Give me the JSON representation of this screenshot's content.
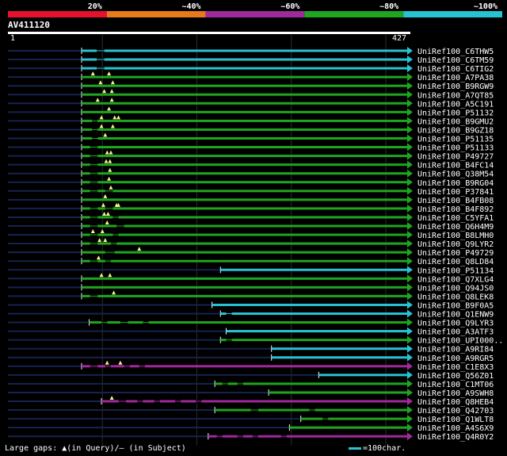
{
  "legend": {
    "segments": [
      {
        "label": "20%",
        "color": "#e8112d"
      },
      {
        "label": "~40%",
        "color": "#e87a1e"
      },
      {
        "label": "~60%",
        "color": "#a0299c"
      },
      {
        "label": "~80%",
        "color": "#1fa51f"
      },
      {
        "label": "~100%",
        "color": "#27c3d3"
      }
    ]
  },
  "query": {
    "name": "AV411120",
    "start": "1",
    "end": "427",
    "length": 427
  },
  "footer": {
    "gaps_text": "Large gaps: ▲(in Query)/— (in Subject)",
    "scale_text": "=100char."
  },
  "colors": {
    "cyan": "#27c3d3",
    "green": "#1fa51f",
    "purple": "#a0299c",
    "navy": "#17224e",
    "marker": "#f3f38f"
  },
  "hits": [
    {
      "name": "UniRef100_C6THW5",
      "color": "cyan",
      "start": 79,
      "gaps": [
        [
          95,
          103
        ]
      ],
      "markers": []
    },
    {
      "name": "UniRef100_C6TM59",
      "color": "cyan",
      "start": 79,
      "gaps": [
        [
          95,
          103
        ]
      ],
      "markers": []
    },
    {
      "name": "UniRef100_C6TIG2",
      "color": "cyan",
      "start": 79,
      "gaps": [
        [
          95,
          103
        ]
      ],
      "markers": []
    },
    {
      "name": "UniRef100_A7PA38",
      "color": "green",
      "start": 79,
      "gaps": [],
      "markers": [
        91,
        108
      ]
    },
    {
      "name": "UniRef100_B9RGW9",
      "color": "green",
      "start": 79,
      "gaps": [],
      "markers": [
        99,
        112
      ]
    },
    {
      "name": "UniRef100_A7QT85",
      "color": "green",
      "start": 79,
      "gaps": [],
      "markers": [
        103,
        111
      ]
    },
    {
      "name": "UniRef100_A5C191",
      "color": "green",
      "start": 79,
      "gaps": [],
      "markers": [
        96,
        111
      ]
    },
    {
      "name": "UniRef100_P51132",
      "color": "green",
      "start": 79,
      "gaps": [],
      "markers": [
        108
      ]
    },
    {
      "name": "UniRef100_B9GMU2",
      "color": "green",
      "start": 79,
      "gaps": [
        [
          90,
          96
        ]
      ],
      "markers": [
        100,
        114,
        118
      ]
    },
    {
      "name": "UniRef100_B9GZ18",
      "color": "green",
      "start": 79,
      "gaps": [
        [
          90,
          96
        ]
      ],
      "markers": [
        100,
        112
      ]
    },
    {
      "name": "UniRef100_P51135",
      "color": "green",
      "start": 79,
      "gaps": [
        [
          90,
          96
        ]
      ],
      "markers": [
        104
      ]
    },
    {
      "name": "UniRef100_P51133",
      "color": "green",
      "start": 79,
      "gaps": [
        [
          88,
          96
        ]
      ],
      "markers": []
    },
    {
      "name": "UniRef100_P49727",
      "color": "green",
      "start": 79,
      "gaps": [
        [
          88,
          96
        ]
      ],
      "markers": [
        106,
        110
      ]
    },
    {
      "name": "UniRef100_B4FC14",
      "color": "green",
      "start": 79,
      "gaps": [
        [
          88,
          96
        ]
      ],
      "markers": [
        105,
        109
      ]
    },
    {
      "name": "UniRef100_Q38M54",
      "color": "green",
      "start": 79,
      "gaps": [
        [
          88,
          96
        ]
      ],
      "markers": [
        109
      ]
    },
    {
      "name": "UniRef100_B9RG04",
      "color": "green",
      "start": 79,
      "gaps": [
        [
          88,
          96
        ]
      ],
      "markers": [
        108
      ]
    },
    {
      "name": "UniRef100_P37841",
      "color": "green",
      "start": 79,
      "gaps": [
        [
          88,
          96
        ],
        [
          104,
          112
        ]
      ],
      "markers": [
        110
      ]
    },
    {
      "name": "UniRef100_B4FB08",
      "color": "green",
      "start": 79,
      "gaps": [],
      "markers": [
        104
      ]
    },
    {
      "name": "UniRef100_B4F892",
      "color": "green",
      "start": 79,
      "gaps": [
        [
          88,
          96
        ],
        [
          104,
          112
        ]
      ],
      "markers": [
        102,
        116,
        118
      ]
    },
    {
      "name": "UniRef100_C5YFA1",
      "color": "green",
      "start": 79,
      "gaps": [
        [
          88,
          96
        ],
        [
          112,
          118
        ]
      ],
      "markers": [
        103,
        107
      ]
    },
    {
      "name": "UniRef100_Q6H4M9",
      "color": "green",
      "start": 79,
      "gaps": [
        [
          88,
          96
        ],
        [
          116,
          124
        ]
      ],
      "markers": [
        106
      ]
    },
    {
      "name": "UniRef100_B8LMH0",
      "color": "green",
      "start": 79,
      "gaps": [
        [
          88,
          96
        ],
        [
          112,
          118
        ]
      ],
      "markers": [
        91,
        101
      ]
    },
    {
      "name": "UniRef100_Q9LYR2",
      "color": "green",
      "start": 79,
      "gaps": [
        [
          88,
          96
        ],
        [
          110,
          116
        ]
      ],
      "markers": [
        98,
        104
      ]
    },
    {
      "name": "UniRef100_P49729",
      "color": "green",
      "start": 79,
      "gaps": [
        [
          104,
          114
        ]
      ],
      "markers": [
        140
      ]
    },
    {
      "name": "UniRef100_Q8LD84",
      "color": "green",
      "start": 79,
      "gaps": [
        [
          88,
          96
        ],
        [
          104,
          110
        ]
      ],
      "markers": [
        97
      ]
    },
    {
      "name": "UniRef100_P51134",
      "color": "cyan",
      "start": 226,
      "gaps": [],
      "markers": []
    },
    {
      "name": "UniRef100_Q7XLG4",
      "color": "green",
      "start": 79,
      "gaps": [],
      "markers": [
        100,
        109
      ]
    },
    {
      "name": "UniRef100_Q94JS0",
      "color": "green",
      "start": 79,
      "gaps": [],
      "markers": []
    },
    {
      "name": "UniRef100_Q8LEK8",
      "color": "green",
      "start": 79,
      "gaps": [
        [
          88,
          96
        ]
      ],
      "markers": [
        113
      ]
    },
    {
      "name": "UniRef100_B9F0A5",
      "color": "cyan",
      "start": 217,
      "gaps": [],
      "markers": []
    },
    {
      "name": "UniRef100_Q1ENW9",
      "color": "cyan",
      "start": 226,
      "gaps": [
        [
          232,
          238
        ]
      ],
      "markers": []
    },
    {
      "name": "UniRef100_Q9LYR3",
      "color": "green",
      "start": 87,
      "gaps": [
        [
          100,
          106
        ],
        [
          120,
          128
        ],
        [
          144,
          150
        ]
      ],
      "markers": []
    },
    {
      "name": "UniRef100_A3ATF3",
      "color": "cyan",
      "start": 232,
      "gaps": [],
      "markers": []
    },
    {
      "name": "UniRef100_UPI000..",
      "color": "green",
      "start": 226,
      "gaps": [
        [
          232,
          238
        ]
      ],
      "markers": []
    },
    {
      "name": "UniRef100_A9RI84",
      "color": "cyan",
      "start": 280,
      "gaps": [],
      "markers": []
    },
    {
      "name": "UniRef100_A9RGR5",
      "color": "cyan",
      "start": 280,
      "gaps": [],
      "markers": []
    },
    {
      "name": "UniRef100_C1E8X3",
      "color": "purple",
      "start": 79,
      "gaps": [
        [
          88,
          96
        ],
        [
          104,
          110
        ],
        [
          124,
          130
        ],
        [
          140,
          146
        ]
      ],
      "markers": [
        106,
        120
      ]
    },
    {
      "name": "UniRef100_Q56Z01",
      "color": "cyan",
      "start": 330,
      "gaps": [],
      "markers": []
    },
    {
      "name": "UniRef100_C1MT06",
      "color": "green",
      "start": 220,
      "gaps": [
        [
          228,
          234
        ],
        [
          244,
          250
        ]
      ],
      "markers": []
    },
    {
      "name": "UniRef100_A9SWH8",
      "color": "green",
      "start": 277,
      "gaps": [],
      "markers": []
    },
    {
      "name": "UniRef100_Q8HEB4",
      "color": "purple",
      "start": 100,
      "gaps": [
        [
          118,
          126
        ],
        [
          138,
          144
        ],
        [
          156,
          162
        ],
        [
          178,
          184
        ],
        [
          200,
          206
        ]
      ],
      "markers": [
        111
      ]
    },
    {
      "name": "UniRef100_Q42703",
      "color": "green",
      "start": 220,
      "gaps": [
        [
          258,
          266
        ],
        [
          320,
          326
        ]
      ],
      "markers": []
    },
    {
      "name": "UniRef100_Q1WLT8",
      "color": "green",
      "start": 311,
      "gaps": [
        [
          334,
          340
        ]
      ],
      "markers": []
    },
    {
      "name": "UniRef100_A4S6X9",
      "color": "green",
      "start": 299,
      "gaps": [],
      "markers": []
    },
    {
      "name": "UniRef100_Q4R0Y2",
      "color": "purple",
      "start": 213,
      "gaps": [
        [
          222,
          228
        ],
        [
          244,
          250
        ],
        [
          260,
          266
        ],
        [
          290,
          296
        ]
      ],
      "markers": []
    }
  ]
}
